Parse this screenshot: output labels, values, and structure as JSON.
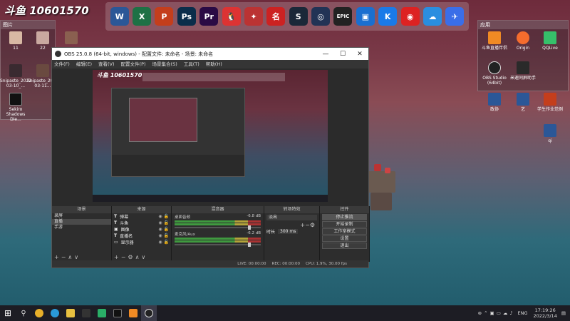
{
  "watermark": "斗鱼 10601570",
  "dock": {
    "icons": [
      {
        "name": "word-icon",
        "glyph": "W",
        "color": "#2b5797"
      },
      {
        "name": "excel-icon",
        "glyph": "X",
        "color": "#1e7145"
      },
      {
        "name": "powerpoint-icon",
        "glyph": "P",
        "color": "#c43e1c"
      },
      {
        "name": "photoshop-icon",
        "glyph": "Ps",
        "color": "#0b2d4a"
      },
      {
        "name": "premiere-icon",
        "glyph": "Pr",
        "color": "#2a0a44"
      },
      {
        "name": "qq-icon",
        "glyph": "🐧",
        "color": "#d33"
      },
      {
        "name": "game-icon-1",
        "glyph": "✦",
        "color": "#b33"
      },
      {
        "name": "game-icon-2",
        "glyph": "名",
        "color": "#c22"
      },
      {
        "name": "steam-icon",
        "glyph": "S",
        "color": "#1b2838"
      },
      {
        "name": "game-icon-3",
        "glyph": "◎",
        "color": "#235"
      },
      {
        "name": "epic-games-icon",
        "glyph": "EPIC",
        "color": "#222"
      },
      {
        "name": "screen-tool-icon",
        "glyph": "▣",
        "color": "#1a6fd0"
      },
      {
        "name": "kugou-icon",
        "glyph": "K",
        "color": "#1a7ae8"
      },
      {
        "name": "netease-music-icon",
        "glyph": "◉",
        "color": "#d22"
      },
      {
        "name": "baidu-netdisk-icon",
        "glyph": "☁",
        "color": "#2a8ee0"
      },
      {
        "name": "feishu-icon",
        "glyph": "✈",
        "color": "#3a6ee8"
      }
    ]
  },
  "left_fence": {
    "title": "图片",
    "icons": [
      "11",
      "22",
      "",
      "Snipaste_2022-03-10_...",
      "Snipaste_2022-03-11...",
      "Sekiro Shadows Die..."
    ]
  },
  "right_fence": {
    "title": "应用",
    "icons": [
      "斗鱼直播伴侣",
      "Origin",
      "QQLive",
      "OBS Studio (64bit)",
      "米速同屏助手"
    ]
  },
  "desktop_files": [
    "政协",
    "艺",
    "学生作业范例",
    "qi"
  ],
  "obs": {
    "title": "OBS 25.0.8 (64-bit, windows) - 配置文件: 未命名 - 场景: 未命名",
    "menu": [
      "文件(F)",
      "编辑(E)",
      "查看(V)",
      "配置文件(P)",
      "场景集合(S)",
      "工具(T)",
      "帮助(H)"
    ],
    "panels": {
      "scenes": {
        "title": "场景",
        "items": [
          "录屏",
          "直播",
          "手游"
        ],
        "selected": 1
      },
      "sources": {
        "title": "来源",
        "items": [
          {
            "t": "T",
            "label": "弹幕"
          },
          {
            "t": "T",
            "label": "斗鱼"
          },
          {
            "t": "▣",
            "label": "图像"
          },
          {
            "t": "T",
            "label": "直播名"
          },
          {
            "t": "▭",
            "label": "显示器"
          }
        ]
      },
      "mixer": {
        "title": "混音器",
        "tracks": [
          {
            "label": "桌面音频",
            "db": "-6.8 dB"
          },
          {
            "label": "麦克风/Aux",
            "db": "-6.2 dB"
          }
        ]
      },
      "transitions": {
        "title": "转场特效",
        "type": "淡出",
        "duration_label": "时长",
        "duration": "300 ms"
      },
      "controls": {
        "title": "控件",
        "buttons": [
          "停止推流",
          "开始录制",
          "工作室模式",
          "设置",
          "退出"
        ]
      }
    },
    "status": {
      "live": "LIVE: 00:00:00",
      "rec": "REC: 00:00:00",
      "cpu": "CPU: 1.9%, 30.00 fps"
    }
  },
  "taskbar": {
    "tray": {
      "lang": "ENG",
      "time": "17:19:26",
      "date": "2022/3/14"
    }
  }
}
